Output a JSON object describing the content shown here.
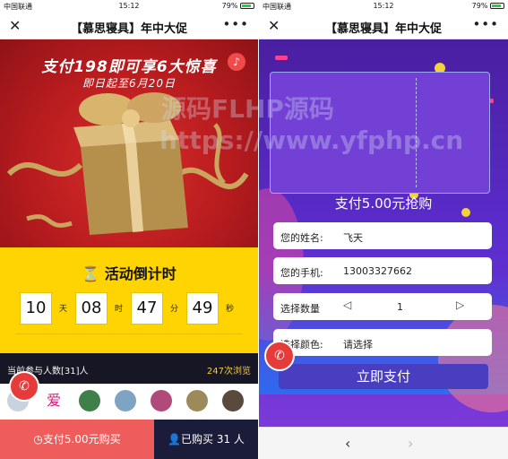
{
  "status_bar": {
    "carrier": "中国联通",
    "time": "15:12",
    "battery": "79%"
  },
  "nav": {
    "title": "【慕思寝具】年中大促",
    "close_glyph": "✕",
    "more_glyph": "•••"
  },
  "left": {
    "headline": "支付198即可享6大惊喜",
    "subline": "即日起至6月20日",
    "countdown_title": "活动倒计时",
    "countdown": [
      {
        "value": "10",
        "unit": "天"
      },
      {
        "value": "08",
        "unit": "时"
      },
      {
        "value": "47",
        "unit": "分"
      },
      {
        "value": "49",
        "unit": "秒"
      }
    ],
    "participants": "当前参与人数[31]人",
    "views": "247次浏览",
    "pay_button": "支付5.00元购买",
    "bought_button": "已购买 31 人",
    "colors": {
      "hero": "#b81c1f",
      "countdown_bg": "#ffd400",
      "pay": "#ee5c5c",
      "bought": "#1b1b3a"
    }
  },
  "right": {
    "coupon_title": "支付5.00元抢购",
    "name_label": "您的姓名:",
    "name_value": "飞天",
    "phone_label": "您的手机:",
    "phone_value": "13003327662",
    "qty_label": "选择数量",
    "qty_value": "1",
    "color_label": "选择颜色:",
    "color_placeholder": "请选择",
    "submit_label": "立即支付"
  },
  "watermark": {
    "line1": "源码FLHP源码",
    "line2": "https://www.yfphp.cn"
  }
}
